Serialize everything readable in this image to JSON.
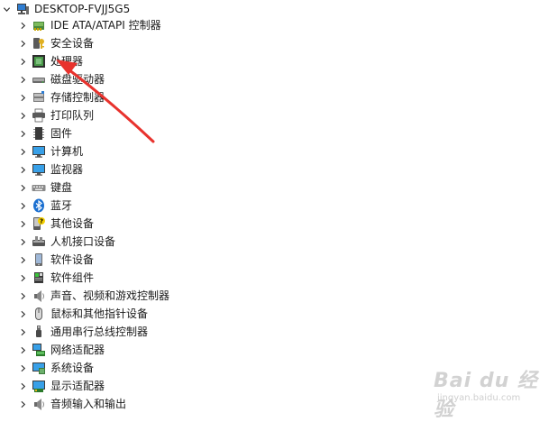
{
  "root": {
    "label": "DESKTOP-FVJJ5G5",
    "icon": "computer-icon",
    "expanded": true
  },
  "items": [
    {
      "label": "IDE ATA/ATAPI 控制器",
      "icon": "ide-controller-icon"
    },
    {
      "label": "安全设备",
      "icon": "security-key-icon"
    },
    {
      "label": "处理器",
      "icon": "processor-chip-icon"
    },
    {
      "label": "磁盘驱动器",
      "icon": "disk-drive-icon"
    },
    {
      "label": "存储控制器",
      "icon": "storage-controller-icon"
    },
    {
      "label": "打印队列",
      "icon": "printer-icon"
    },
    {
      "label": "固件",
      "icon": "firmware-icon"
    },
    {
      "label": "计算机",
      "icon": "monitor-icon"
    },
    {
      "label": "监视器",
      "icon": "monitor-icon"
    },
    {
      "label": "键盘",
      "icon": "keyboard-icon"
    },
    {
      "label": "蓝牙",
      "icon": "bluetooth-icon"
    },
    {
      "label": "其他设备",
      "icon": "unknown-device-icon"
    },
    {
      "label": "人机接口设备",
      "icon": "hid-icon"
    },
    {
      "label": "软件设备",
      "icon": "software-device-icon"
    },
    {
      "label": "软件组件",
      "icon": "software-component-icon"
    },
    {
      "label": "声音、视频和游戏控制器",
      "icon": "speaker-icon"
    },
    {
      "label": "鼠标和其他指针设备",
      "icon": "mouse-icon"
    },
    {
      "label": "通用串行总线控制器",
      "icon": "usb-icon"
    },
    {
      "label": "网络适配器",
      "icon": "network-adapter-icon"
    },
    {
      "label": "系统设备",
      "icon": "system-device-icon"
    },
    {
      "label": "显示适配器",
      "icon": "display-adapter-icon"
    },
    {
      "label": "音频输入和输出",
      "icon": "speaker-icon"
    }
  ],
  "annotation": {
    "color": "#e8322d",
    "points_to": "处理器"
  },
  "watermark": {
    "logo": "Bai du 经验",
    "sub": "jingyan.baidu.com"
  },
  "colors": {
    "accent_blue": "#2f7dd1",
    "chip_green": "#3c7a3c"
  }
}
